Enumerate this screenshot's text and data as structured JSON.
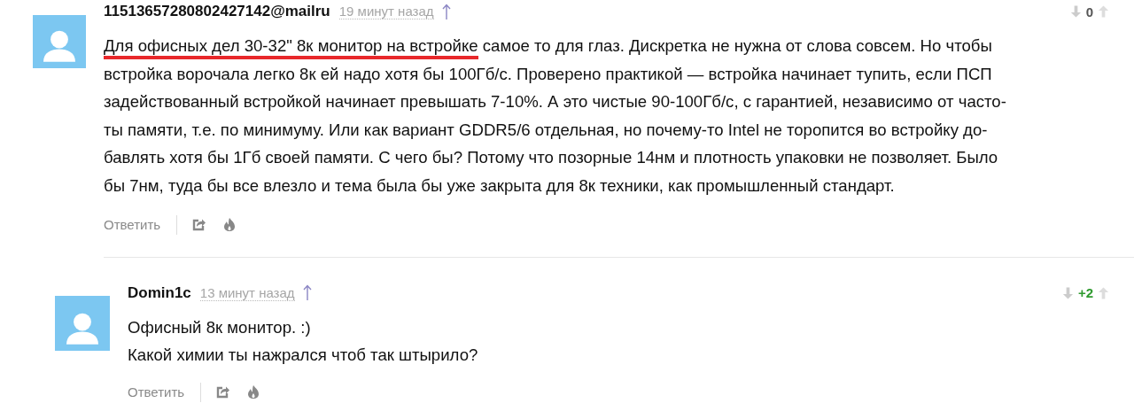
{
  "comments": [
    {
      "author": "11513657280802427142@mailru",
      "time": "19 минут назад",
      "score": "0",
      "color": "#555555",
      "segments": [
        {
          "text": "Для офисных дел 30-32\" 8к монитор на встройке",
          "underlined": true
        },
        {
          "text": " самое то для глаз. Дискретка не нужна от слова совсем. Но чтобы\nвстройка ворочала легко 8к ей надо хотя бы 100Гб/с. Проверено практикой — встройка начинает тупить, если ПСП\nзадействованный встройкой начинает превышать 7-10%. А это чистые 90-100Гб/с, с гарантией, независимо от часто-\nты памяти, т.е. по минимуму. Или как вариант GDDR5/6 отдельная, но почему-то Intel не торопится во встройку до-\nбавлять хотя бы 1Гб своей памяти. С чего бы? Потому что позорные 14нм и плотность упаковки не позволяет. Было\nбы 7нм, туда бы все влезло и тема была бы уже закрыта для 8к техники, как промышленный стандарт.",
          "underlined": false
        }
      ],
      "reply": "Ответить",
      "children": [
        {
          "author": "Domin1c",
          "time": "13 минут назад",
          "score": "+2",
          "color": "#2e9a2e",
          "segments": [
            {
              "text": "Офисный 8к монитор. :)\nКакой химии ты нажрался чтоб так штырило?",
              "underlined": false
            }
          ],
          "reply": "Ответить"
        }
      ]
    }
  ]
}
